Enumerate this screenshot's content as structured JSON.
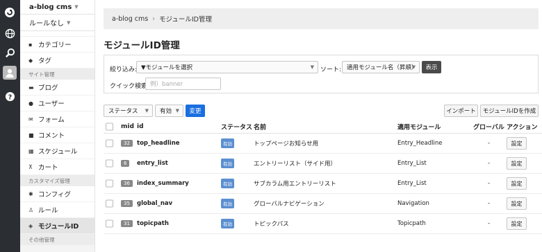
{
  "sidebar": {
    "site_name": "a-blog cms",
    "rule": "ルールなし",
    "items_top": [
      {
        "label": "カテゴリー",
        "icon": "folder-icon"
      },
      {
        "label": "タグ",
        "icon": "tag-icon"
      }
    ],
    "section_site": "サイト管理",
    "items_site": [
      {
        "label": "ブログ",
        "icon": "blog-icon"
      },
      {
        "label": "ユーザー",
        "icon": "user-icon"
      },
      {
        "label": "フォーム",
        "icon": "form-icon"
      },
      {
        "label": "コメント",
        "icon": "comment-icon"
      },
      {
        "label": "スケジュール",
        "icon": "calendar-icon"
      },
      {
        "label": "カート",
        "icon": "cart-icon"
      }
    ],
    "section_custom": "カスタマイズ管理",
    "items_custom": [
      {
        "label": "コンフィグ",
        "icon": "gear-icon"
      },
      {
        "label": "ルール",
        "icon": "rule-icon"
      },
      {
        "label": "モジュールID",
        "icon": "cube-icon"
      }
    ],
    "section_other": "その他管理"
  },
  "breadcrumb": {
    "root": "a-blog cms",
    "current": "モジュールID管理"
  },
  "page_title": "モジュールID管理",
  "filter": {
    "narrow_label": "絞り込み:",
    "module_select": "▼モジュールを選択",
    "sort_label": "ソート:",
    "sort_select": "適用モジュール名（昇順）",
    "show_button": "表示",
    "quick_label": "クイック検索:",
    "quick_placeholder": "例）banner"
  },
  "toolbar": {
    "status_select": "ステータス",
    "value_select": "有効",
    "change_button": "変更",
    "import_button": "インポート",
    "create_button": "モジュールIDを作成"
  },
  "table": {
    "headers": {
      "mid": "mid",
      "id": "id",
      "status": "ステータス",
      "name": "名前",
      "module": "適用モジュール",
      "global": "グローバル",
      "action": "アクション"
    },
    "rows": [
      {
        "mid": "32",
        "id": "top_headline",
        "status": "有効",
        "name": "トップページお知らせ用",
        "module": "Entry_Headline",
        "global": "-",
        "action": "設定"
      },
      {
        "mid": "6",
        "id": "entry_list",
        "status": "有効",
        "name": "エントリーリスト（サイド用）",
        "module": "Entry_List",
        "global": "-",
        "action": "設定"
      },
      {
        "mid": "36",
        "id": "index_summary",
        "status": "有効",
        "name": "サブカラム用エントリーリスト",
        "module": "Entry_List",
        "global": "-",
        "action": "設定"
      },
      {
        "mid": "35",
        "id": "global_nav",
        "status": "有効",
        "name": "グローバルナビゲーション",
        "module": "Navigation",
        "global": "-",
        "action": "設定"
      },
      {
        "mid": "31",
        "id": "topicpath",
        "status": "有効",
        "name": "トピックパス",
        "module": "Topicpath",
        "global": "-",
        "action": "設定"
      }
    ]
  }
}
